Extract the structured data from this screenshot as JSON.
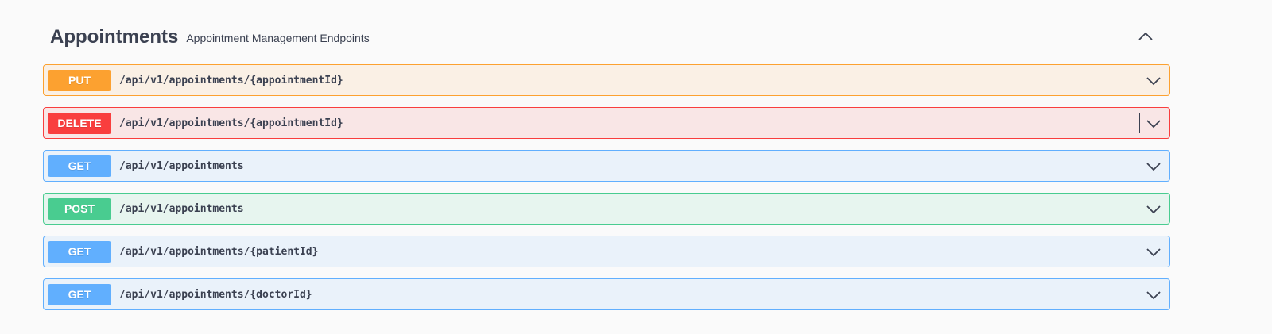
{
  "tag": {
    "title": "Appointments",
    "description": "Appointment Management Endpoints"
  },
  "operations": [
    {
      "method": "PUT",
      "path": "/api/v1/appointments/{appointmentId}"
    },
    {
      "method": "DELETE",
      "path": "/api/v1/appointments/{appointmentId}"
    },
    {
      "method": "GET",
      "path": "/api/v1/appointments"
    },
    {
      "method": "POST",
      "path": "/api/v1/appointments"
    },
    {
      "method": "GET",
      "path": "/api/v1/appointments/{patientId}"
    },
    {
      "method": "GET",
      "path": "/api/v1/appointments/{doctorId}"
    }
  ],
  "colors": {
    "put": "#fca130",
    "delete": "#f93e3e",
    "get": "#61affe",
    "post": "#49cc90",
    "text": "#3b4151"
  },
  "icons": {
    "collapse": "chevron-up-icon",
    "expand": "chevron-down-icon"
  }
}
